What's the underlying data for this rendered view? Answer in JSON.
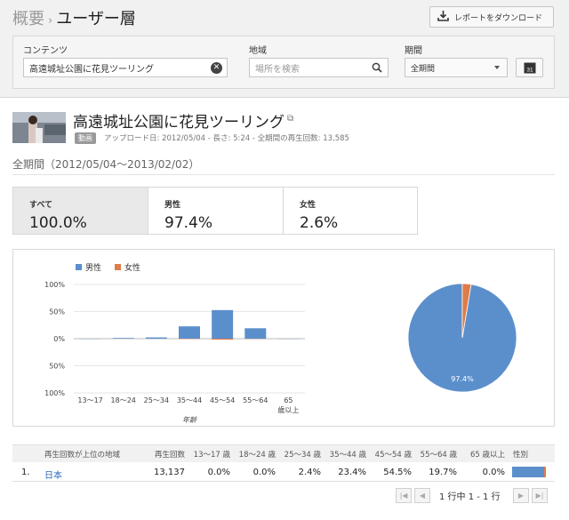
{
  "breadcrumb": {
    "parent": "概要",
    "current": "ユーザー層"
  },
  "toolbar": {
    "download_label": "レポートをダウンロード"
  },
  "filters": {
    "content_label": "コンテンツ",
    "content_value": "高遠城址公園に花見ツーリング",
    "location_label": "地域",
    "location_placeholder": "場所を検索",
    "period_label": "期間",
    "period_value": "全期間",
    "calendar_day": "31"
  },
  "video": {
    "title": "高遠城址公園に花見ツーリング",
    "badge": "動画",
    "meta": "アップロード日: 2012/05/04 - 長さ: 5:24 - 全期間の再生回数: 13,585"
  },
  "period_range": "全期間（2012/05/04〜2013/02/02）",
  "tabs": [
    {
      "label": "すべて",
      "value": "100.0%"
    },
    {
      "label": "男性",
      "value": "97.4%"
    },
    {
      "label": "女性",
      "value": "2.6%"
    }
  ],
  "colors": {
    "male": "#5b8fcc",
    "female": "#e07b4a"
  },
  "chart_data": [
    {
      "type": "bar",
      "categories": [
        "13〜17",
        "18〜24",
        "25〜34",
        "35〜44",
        "45〜54",
        "55〜64",
        "65 歳以上"
      ],
      "series": [
        {
          "name": "男性",
          "values": [
            0,
            0.5,
            2.3,
            22.7,
            52.7,
            19.2,
            0
          ]
        },
        {
          "name": "女性",
          "values": [
            0,
            0,
            0.1,
            0.7,
            1.8,
            0.5,
            0
          ]
        }
      ],
      "xlabel": "年齢",
      "y_ticks": [
        "100%",
        "50%",
        "0%",
        "50%",
        "100%"
      ],
      "ylim": [
        -100,
        100
      ],
      "legend": "top-left"
    },
    {
      "type": "pie",
      "labels": [
        "男性",
        "女性"
      ],
      "values": [
        97.4,
        2.6
      ],
      "data_label": "97.4%"
    }
  ],
  "table": {
    "headers": [
      "再生回数が上位の地域",
      "再生回数",
      "13〜17 歳",
      "18〜24 歳",
      "25〜34 歳",
      "35〜44 歳",
      "45〜54 歳",
      "55〜64 歳",
      "65 歳以上",
      "性別"
    ],
    "rows": [
      {
        "rank": "1.",
        "region": "日本",
        "views": "13,137",
        "a13": "0.0%",
        "a18": "0.0%",
        "a25": "2.4%",
        "a35": "23.4%",
        "a45": "54.5%",
        "a55": "19.7%",
        "a65": "0.0%",
        "male_share": 97.4
      }
    ]
  },
  "pager": {
    "text": "1 行中 1 - 1 行"
  }
}
